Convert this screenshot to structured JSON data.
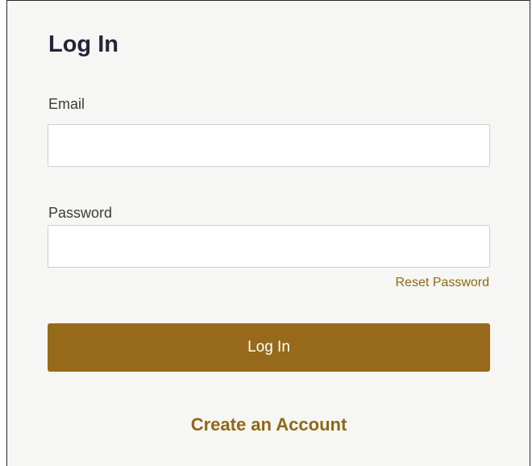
{
  "form": {
    "title": "Log In",
    "email_label": "Email",
    "email_value": "",
    "password_label": "Password",
    "password_value": "",
    "reset_password_label": "Reset Password",
    "login_button_label": "Log In",
    "create_account_label": "Create an Account"
  },
  "colors": {
    "accent": "#966a1a",
    "link": "#8e6718",
    "panel_background": "#f6f6f4",
    "title_text": "#24243a"
  }
}
